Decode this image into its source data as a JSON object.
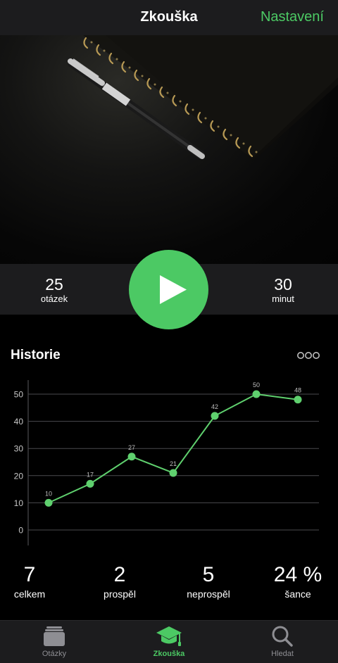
{
  "nav": {
    "title": "Zkouška",
    "settings_label": "Nastavení"
  },
  "hero": {
    "image_desc_icon": "notebook-pen-photo"
  },
  "start": {
    "questions_count": "25",
    "questions_label": "otázek",
    "minutes_count": "30",
    "minutes_label": "minut",
    "play_icon": "play-icon"
  },
  "history": {
    "title": "Historie",
    "more_icon": "ellipsis-icon"
  },
  "chart_data": {
    "type": "line",
    "x": [
      1,
      2,
      3,
      4,
      5,
      6,
      7
    ],
    "series": [
      {
        "values": [
          10,
          17,
          27,
          21,
          42,
          50,
          48
        ]
      }
    ],
    "ylim": [
      0,
      50
    ],
    "yticks": [
      "0",
      "10",
      "20",
      "30",
      "40",
      "50"
    ],
    "grid": true,
    "color": "#5fd06e"
  },
  "summary": [
    {
      "value": "7",
      "label": "celkem"
    },
    {
      "value": "2",
      "label": "prospěl"
    },
    {
      "value": "5",
      "label": "neprospěl"
    },
    {
      "value": "24 %",
      "label": "šance"
    }
  ],
  "tabs": [
    {
      "label": "Otázky",
      "icon": "cards-icon",
      "active": false
    },
    {
      "label": "Zkouška",
      "icon": "graduation-cap-icon",
      "active": true
    },
    {
      "label": "Hledat",
      "icon": "search-icon",
      "active": false
    }
  ],
  "colors": {
    "accent": "#4cc964",
    "bar": "#1c1c1e",
    "background": "#000000"
  }
}
